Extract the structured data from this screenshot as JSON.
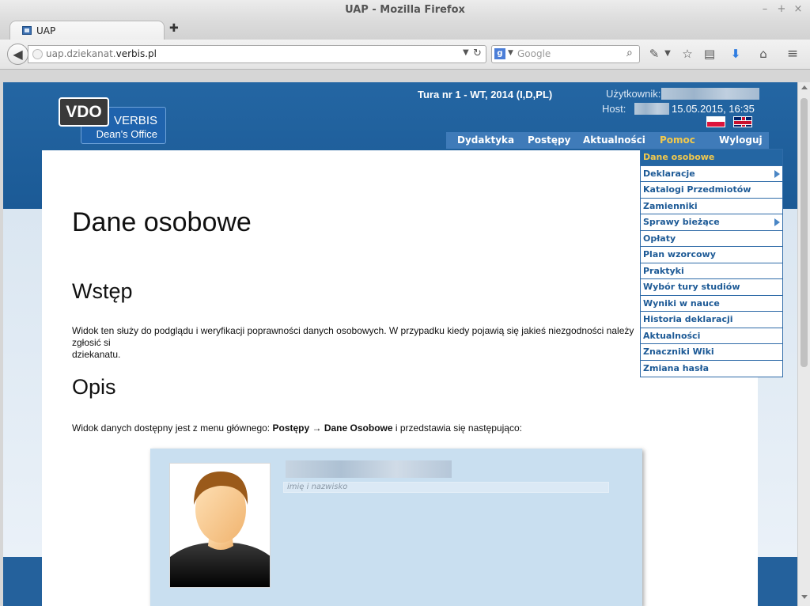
{
  "window": {
    "title": "UAP - Mozilla Firefox"
  },
  "tab": {
    "title": "UAP",
    "newtab_symbol": "✚"
  },
  "urlbar": {
    "prefix": "uap.dziekanat.",
    "domain": "verbis.pl",
    "suffix": ".pl"
  },
  "search": {
    "placeholder": "Google",
    "engine_letter": "g"
  },
  "header": {
    "logo_vdo": "VDO",
    "logo_verbis": "VERBIS",
    "logo_office": "Dean's Office",
    "tura": "Tura nr 1 - WT, 2014 (I,D,PL)",
    "user_label": "Użytkownik:",
    "host_label": "Host:",
    "datetime": "15.05.2015, 16:35"
  },
  "nav": {
    "items": [
      "Dydaktyka",
      "Postępy",
      "Aktualności",
      "Pomoc",
      "Wyloguj"
    ]
  },
  "dropdown": {
    "items": [
      "Dane osobowe",
      "Deklaracje",
      "Katalogi Przedmiotów",
      "Zamienniki",
      "Sprawy bieżące",
      "Opłaty",
      "Plan wzorcowy",
      "Praktyki",
      "Wybór tury studiów",
      "Wyniki w nauce",
      "Historia deklaracji",
      "Aktualności",
      "Znaczniki Wiki",
      "Zmiana hasła"
    ]
  },
  "content": {
    "title": "Dane osobowe",
    "h_wstep": "Wstęp",
    "intro": "Widok ten służy do podglądu i weryfikacji poprawności danych osobowych. W przypadku kiedy pojawią się jakieś niezgodności należy zgłosić si",
    "intro2": "dziekanatu.",
    "h_opis": "Opis",
    "opis_pre": "Widok danych dostępny jest z menu głównego: ",
    "opis_path1": "Postępy",
    "opis_arrow": " → ",
    "opis_path2": "Dane Osobowe",
    "opis_post": " i przedstawia się następująco:"
  },
  "profile": {
    "name_caption": "imię i nazwisko"
  },
  "colors": {
    "header_blue": "#2466a3",
    "menu_active": "#f2c94c",
    "menu_link": "#1d5a96"
  }
}
